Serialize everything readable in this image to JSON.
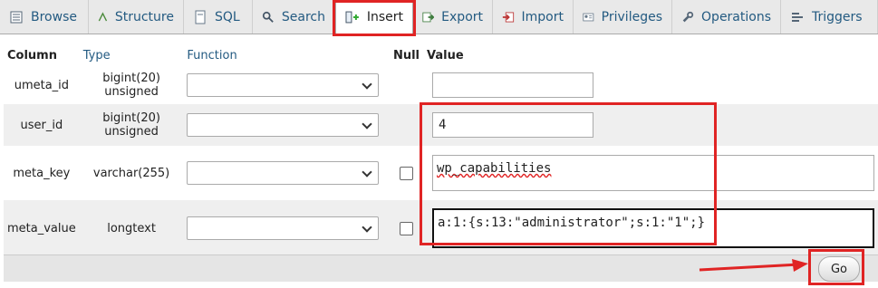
{
  "tabs": [
    {
      "label": "Browse",
      "icon": "browse-icon"
    },
    {
      "label": "Structure",
      "icon": "structure-icon"
    },
    {
      "label": "SQL",
      "icon": "sql-icon"
    },
    {
      "label": "Search",
      "icon": "search-icon"
    },
    {
      "label": "Insert",
      "icon": "insert-icon",
      "active": true
    },
    {
      "label": "Export",
      "icon": "export-icon"
    },
    {
      "label": "Import",
      "icon": "import-icon"
    },
    {
      "label": "Privileges",
      "icon": "privileges-icon"
    },
    {
      "label": "Operations",
      "icon": "operations-icon"
    },
    {
      "label": "Triggers",
      "icon": "triggers-icon"
    }
  ],
  "headers": {
    "column": "Column",
    "type": "Type",
    "function": "Function",
    "null": "Null",
    "value": "Value"
  },
  "rows": [
    {
      "column": "umeta_id",
      "type": "bigint(20) unsigned",
      "function": "",
      "value": ""
    },
    {
      "column": "user_id",
      "type": "bigint(20) unsigned",
      "function": "",
      "value": "4"
    },
    {
      "column": "meta_key",
      "type": "varchar(255)",
      "function": "",
      "value": "wp_capabilities"
    },
    {
      "column": "meta_value",
      "type": "longtext",
      "function": "",
      "value": "a:1:{s:13:\"administrator\";s:1:\"1\";}"
    }
  ],
  "go_label": "Go",
  "colors": {
    "highlight": "#e02424",
    "link": "#235a81",
    "row_alt": "#efefef"
  }
}
